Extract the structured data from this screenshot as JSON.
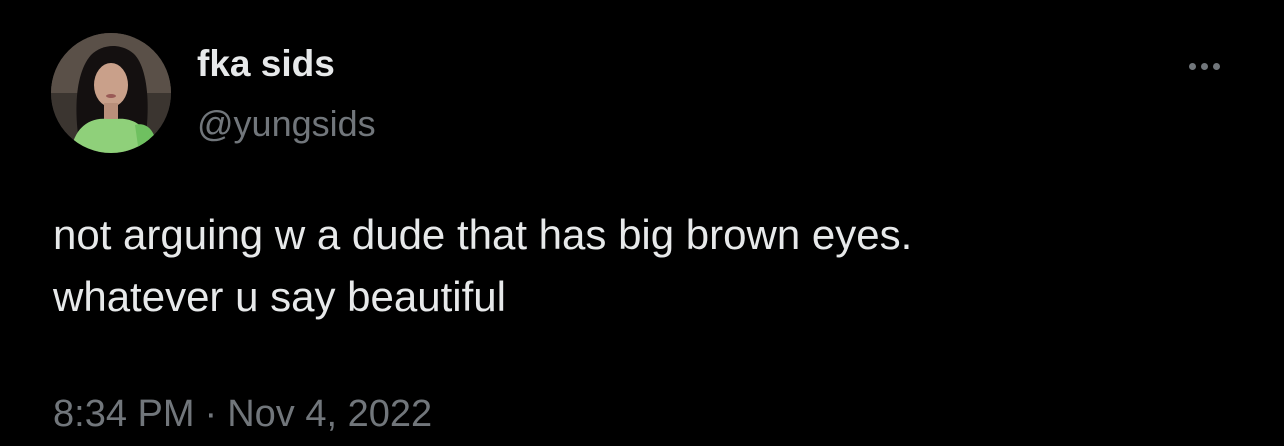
{
  "author": {
    "display_name": "fka sids",
    "handle": "@yungsids",
    "avatar": "avatar-photo"
  },
  "more_icon": "more-horizontal-icon",
  "tweet": {
    "lines": [
      "not arguing w a dude that has big brown eyes.",
      "whatever u say beautiful"
    ]
  },
  "meta": {
    "time": "8:34 PM",
    "separator": "·",
    "date": "Nov 4, 2022"
  },
  "colors": {
    "background": "#000000",
    "primary_text": "#e7e9ea",
    "secondary_text": "#71767b"
  }
}
